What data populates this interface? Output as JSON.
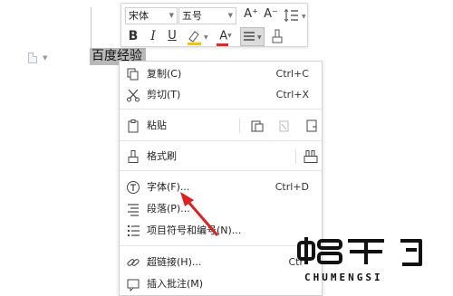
{
  "document": {
    "selected_text": "百度经验"
  },
  "toolbar": {
    "font_name": "宋体",
    "font_size": "五号",
    "grow_font_icon": "A⁺",
    "shrink_font_icon": "A⁻",
    "bold": "B",
    "italic": "I",
    "underline": "U",
    "font_color_letter": "A",
    "colors": {
      "highlight": "#f2c500",
      "font": "#e3262a"
    }
  },
  "menu": {
    "items": [
      {
        "label": "复制(C)",
        "shortcut": "Ctrl+C"
      },
      {
        "label": "剪切(T)",
        "shortcut": "Ctrl+X"
      },
      {
        "label": "粘贴",
        "shortcut": ""
      },
      {
        "label": "格式刷",
        "shortcut": ""
      },
      {
        "label": "字体(F)...",
        "shortcut": "Ctrl+D"
      },
      {
        "label": "段落(P)...",
        "shortcut": ""
      },
      {
        "label": "项目符号和编号(N)...",
        "shortcut": ""
      },
      {
        "label": "超链接(H)...",
        "shortcut": "Ctr"
      },
      {
        "label": "插入批注(M)",
        "shortcut": ""
      }
    ]
  },
  "watermark": {
    "brand_text": "CHUMENGSI"
  }
}
